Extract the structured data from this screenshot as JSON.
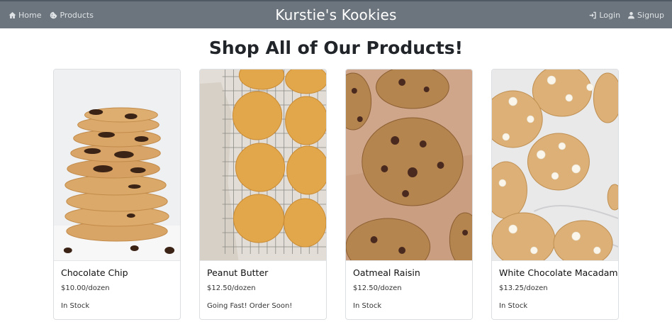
{
  "nav": {
    "home": {
      "label": "Home",
      "icon": "home-icon"
    },
    "products": {
      "label": "Products",
      "icon": "cookie-icon"
    },
    "brand": "Kurstie's Kookies",
    "login": {
      "label": "Login",
      "icon": "login-icon"
    },
    "signup": {
      "label": "Signup",
      "icon": "user-icon"
    }
  },
  "page": {
    "title": "Shop All of Our Products!"
  },
  "products": [
    {
      "name": "Chocolate Chip",
      "price": "$10.00/dozen",
      "status": "In Stock",
      "image": "stacked chocolate chip cookies"
    },
    {
      "name": "Peanut Butter",
      "price": "$12.50/dozen",
      "status": "Going Fast! Order Soon!",
      "image": "peanut butter cookies on cooling rack"
    },
    {
      "name": "Oatmeal Raisin",
      "price": "$12.50/dozen",
      "status": "In Stock",
      "image": "oatmeal raisin cookies on parchment"
    },
    {
      "name": "White Chocolate Macadamia",
      "price": "$13.25/dozen",
      "status": "In Stock",
      "image": "white chocolate macadamia cookies on marble"
    }
  ],
  "colors": {
    "navbar": "#6c757d",
    "nav_text": "#dfe3e6",
    "brand_text": "#ffffff"
  }
}
